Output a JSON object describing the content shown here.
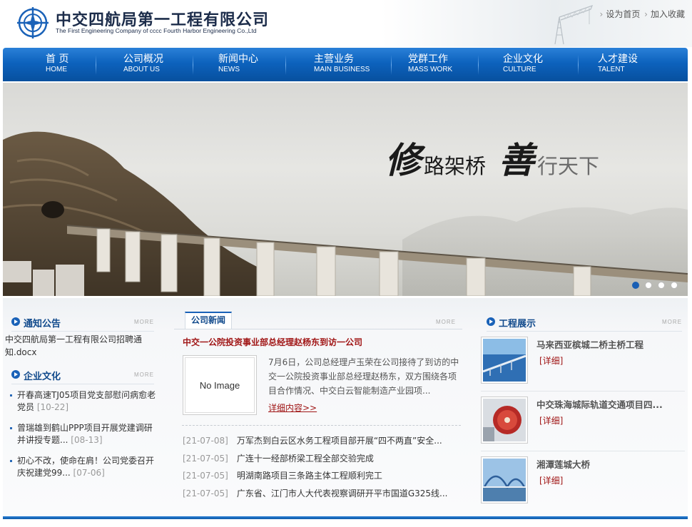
{
  "header": {
    "company_cn": "中交四航局第一工程有限公司",
    "company_en": "The First Engineering Company of cccc Fourth Harbor Engineering Co.,Ltd",
    "links": [
      "设为首页",
      "加入收藏"
    ],
    "brand_color": "#1a62b8"
  },
  "nav": [
    {
      "cn": "首 页",
      "en": "HOME"
    },
    {
      "cn": "公司概况",
      "en": "ABOUT US"
    },
    {
      "cn": "新闻中心",
      "en": "NEWS"
    },
    {
      "cn": "主营业务",
      "en": "MAIN BUSINESS"
    },
    {
      "cn": "党群工作",
      "en": "MASS WORK"
    },
    {
      "cn": "企业文化",
      "en": "CULTURE"
    },
    {
      "cn": "人才建设",
      "en": "TALENT"
    }
  ],
  "banner": {
    "slogan": {
      "c1": "修",
      "c2": "路架桥",
      "c3": "善",
      "c4": "行天下"
    },
    "slides": 4,
    "active_slide": 1
  },
  "notice": {
    "title": "通知公告",
    "more": "MORE",
    "text": "中交四航局第一工程有限公司招聘通知.docx"
  },
  "culture": {
    "title": "企业文化",
    "more": "MORE",
    "items": [
      {
        "text": "开春高速TJ05项目党支部慰问病愈老党员",
        "date": "[10-22]"
      },
      {
        "text": "曾瑞雄到鹤山PPP项目开展党建调研并讲授专题...",
        "date": "[08-13]"
      },
      {
        "text": "初心不改，使命在肩！公司党委召开庆祝建党99...",
        "date": "[07-06]"
      }
    ]
  },
  "news": {
    "tab": "公司新闻",
    "more": "MORE",
    "headline": "中交一公院投资事业部总经理赵杨东到访一公司",
    "noimage": "No Image",
    "summary": "7月6日，公司总经理卢玉荣在公司接待了到访的中交一公院投资事业部总经理赵杨东，双方围绕各项目合作情况、中交白云智能制造产业园项...",
    "detail": "详细内容>>",
    "items": [
      {
        "date": "[21-07-08]",
        "title": "万军杰到白云区水务工程项目部开展“四不两直”安全..."
      },
      {
        "date": "[21-07-05]",
        "title": "广连十一经部桥梁工程全部交验完成"
      },
      {
        "date": "[21-07-05]",
        "title": "明湖南路项目三条路主体工程顺利完工"
      },
      {
        "date": "[21-07-05]",
        "title": "广东省、江门市人大代表视察调研开平市国道G325线..."
      }
    ]
  },
  "projects": {
    "title": "工程展示",
    "more": "MORE",
    "items": [
      {
        "title": "马来西亚槟城二桥主桥工程",
        "detail": "[详细]",
        "icon": "bridge-sea-thumb"
      },
      {
        "title": "中交珠海城际轨道交通项目四...",
        "detail": "[详细]",
        "icon": "tunnel-machine-thumb"
      },
      {
        "title": "湘潭莲城大桥",
        "detail": "[详细]",
        "icon": "arch-bridge-thumb"
      }
    ]
  }
}
